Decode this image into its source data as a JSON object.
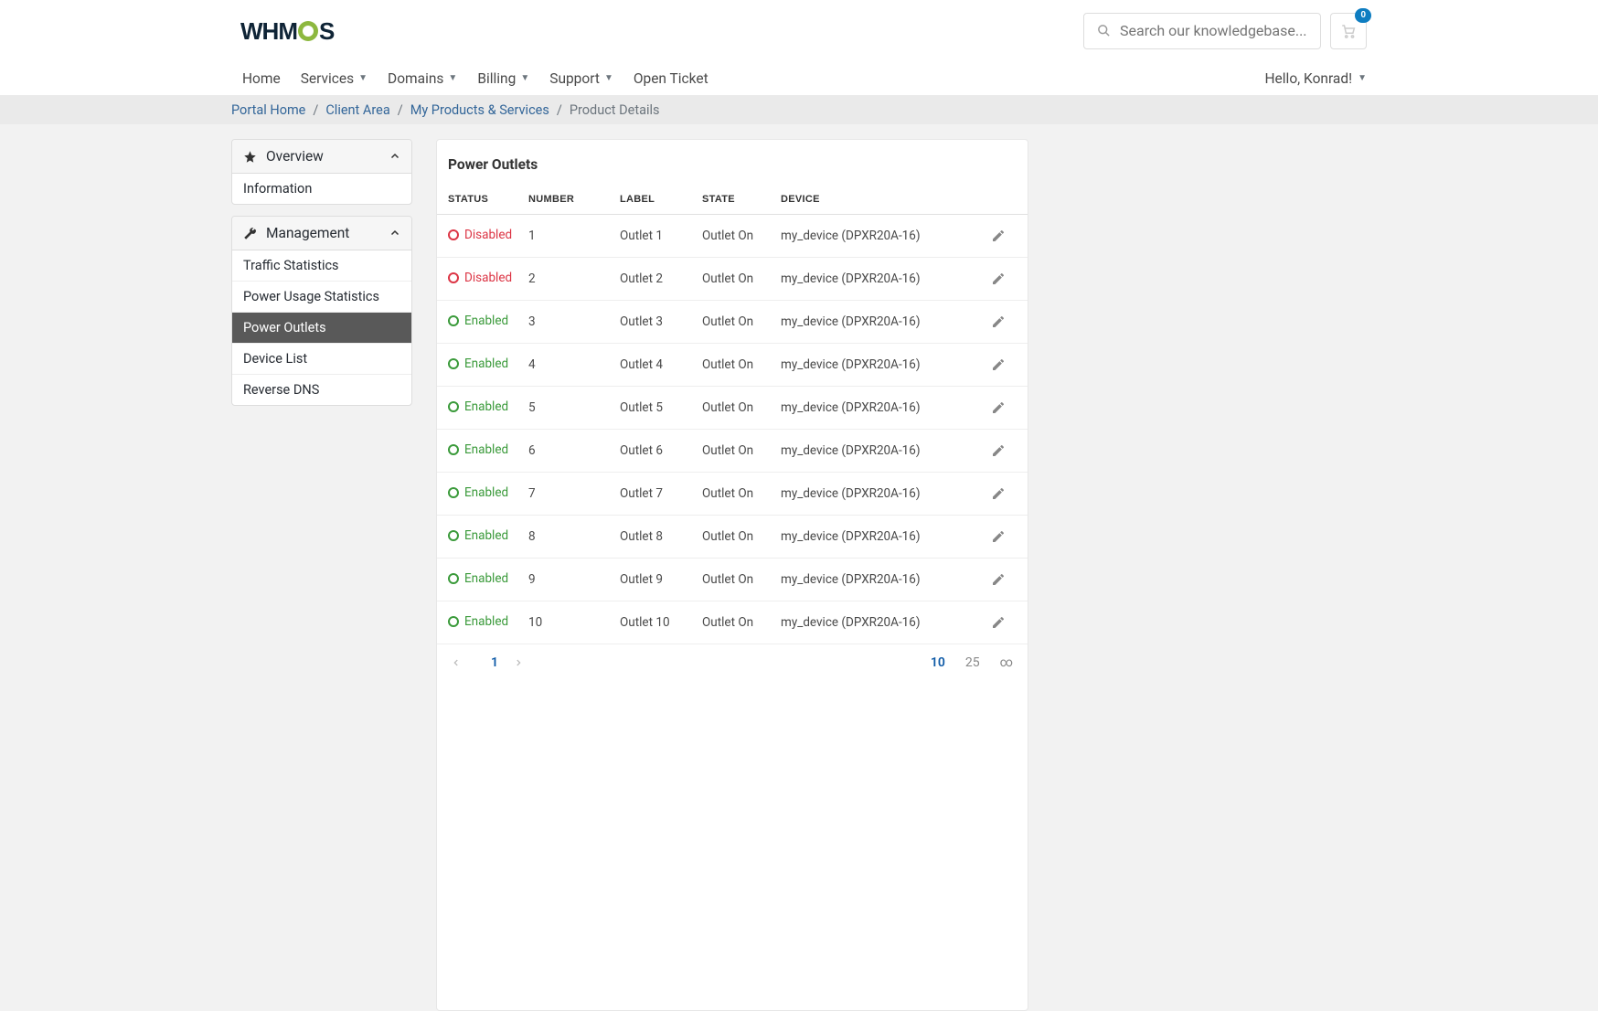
{
  "header": {
    "search_placeholder": "Search our knowledgebase...",
    "cart_count": "0"
  },
  "nav": {
    "items": [
      "Home",
      "Services",
      "Domains",
      "Billing",
      "Support",
      "Open Ticket"
    ],
    "greeting": "Hello, Konrad!"
  },
  "breadcrumb": {
    "items": [
      "Portal Home",
      "Client Area",
      "My Products & Services"
    ],
    "current": "Product Details"
  },
  "sidebar": {
    "overview": {
      "title": "Overview",
      "items": [
        "Information"
      ]
    },
    "management": {
      "title": "Management",
      "items": [
        "Traffic Statistics",
        "Power Usage Statistics",
        "Power Outlets",
        "Device List",
        "Reverse DNS"
      ],
      "active": 2
    }
  },
  "main": {
    "title": "Power Outlets",
    "columns": [
      "STATUS",
      "NUMBER",
      "LABEL",
      "STATE",
      "DEVICE"
    ],
    "status_labels": {
      "enabled": "Enabled",
      "disabled": "Disabled"
    },
    "rows": [
      {
        "status": "disabled",
        "number": "1",
        "label": "Outlet 1",
        "state": "Outlet On",
        "device": "my_device (DPXR20A-16)"
      },
      {
        "status": "disabled",
        "number": "2",
        "label": "Outlet 2",
        "state": "Outlet On",
        "device": "my_device (DPXR20A-16)"
      },
      {
        "status": "enabled",
        "number": "3",
        "label": "Outlet 3",
        "state": "Outlet On",
        "device": "my_device (DPXR20A-16)"
      },
      {
        "status": "enabled",
        "number": "4",
        "label": "Outlet 4",
        "state": "Outlet On",
        "device": "my_device (DPXR20A-16)"
      },
      {
        "status": "enabled",
        "number": "5",
        "label": "Outlet 5",
        "state": "Outlet On",
        "device": "my_device (DPXR20A-16)"
      },
      {
        "status": "enabled",
        "number": "6",
        "label": "Outlet 6",
        "state": "Outlet On",
        "device": "my_device (DPXR20A-16)"
      },
      {
        "status": "enabled",
        "number": "7",
        "label": "Outlet 7",
        "state": "Outlet On",
        "device": "my_device (DPXR20A-16)"
      },
      {
        "status": "enabled",
        "number": "8",
        "label": "Outlet 8",
        "state": "Outlet On",
        "device": "my_device (DPXR20A-16)"
      },
      {
        "status": "enabled",
        "number": "9",
        "label": "Outlet 9",
        "state": "Outlet On",
        "device": "my_device (DPXR20A-16)"
      },
      {
        "status": "enabled",
        "number": "10",
        "label": "Outlet 10",
        "state": "Outlet On",
        "device": "my_device (DPXR20A-16)"
      }
    ],
    "pager": {
      "current": "1",
      "sizes": [
        "10",
        "25",
        "∞"
      ],
      "size_selected": 0
    }
  }
}
